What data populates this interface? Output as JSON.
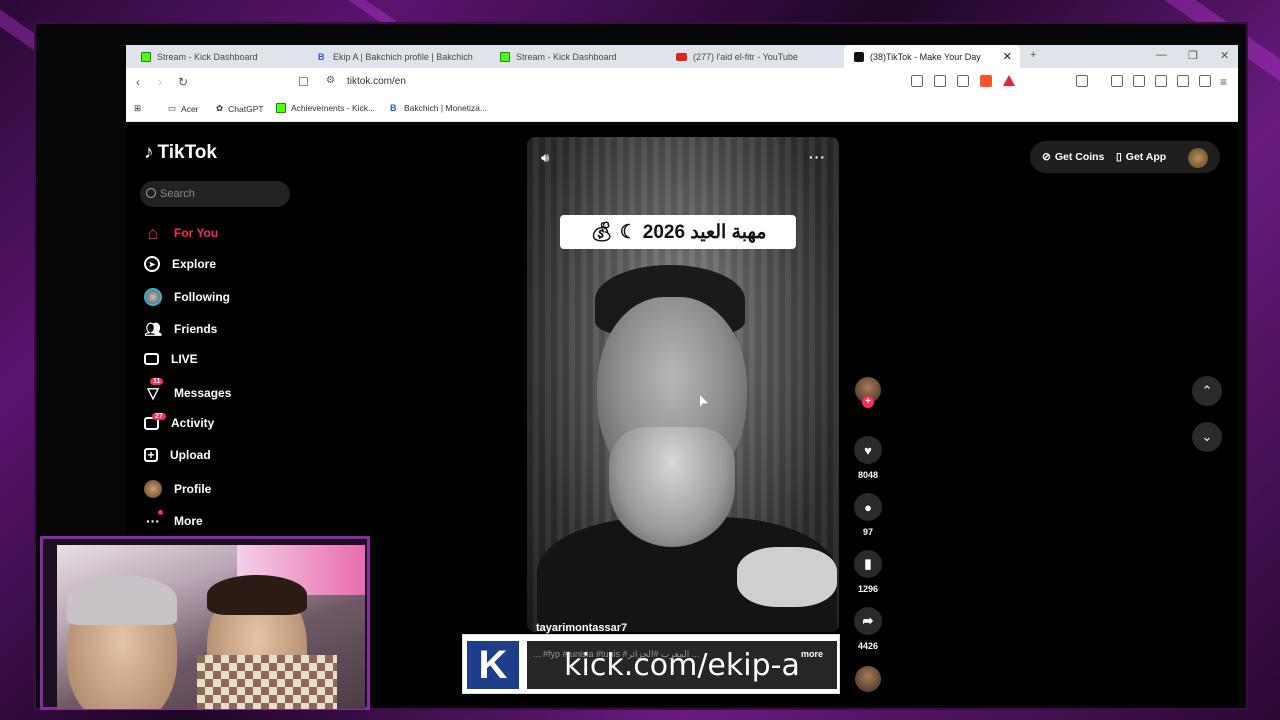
{
  "browser": {
    "tabs": [
      {
        "title": "Stream - Kick Dashboard",
        "favicon": "kick-icon",
        "active": false
      },
      {
        "title": "Ekip A | Bakchich profile | Bakchich",
        "favicon": "bakchich-icon",
        "active": false
      },
      {
        "title": "Stream - Kick Dashboard",
        "favicon": "kick-icon",
        "active": false
      },
      {
        "title": "(277) l'aid el-fitr - YouTube",
        "favicon": "youtube-icon",
        "active": false
      },
      {
        "title": "(38)TikTok - Make Your Day",
        "favicon": "tiktok-icon",
        "active": true
      }
    ],
    "url": "tiktok.com/en",
    "bookmarks": [
      "Acer",
      "ChatGPT",
      "Achievements - Kick...",
      "Bakchich | Monetiza..."
    ]
  },
  "tiktok": {
    "logo": "TikTok",
    "search_placeholder": "Search",
    "nav": [
      {
        "label": "For You",
        "icon": "home-icon",
        "active": true
      },
      {
        "label": "Explore",
        "icon": "compass-icon"
      },
      {
        "label": "Following",
        "icon": "following-avatar-icon"
      },
      {
        "label": "Friends",
        "icon": "friends-icon"
      },
      {
        "label": "LIVE",
        "icon": "live-tv-icon"
      },
      {
        "label": "Messages",
        "icon": "send-icon",
        "badge": "11"
      },
      {
        "label": "Activity",
        "icon": "activity-icon",
        "badge": "27"
      },
      {
        "label": "Upload",
        "icon": "upload-icon"
      },
      {
        "label": "Profile",
        "icon": "profile-avatar-icon"
      },
      {
        "label": "More",
        "icon": "more-dots-icon"
      }
    ],
    "top": {
      "get_coins": "Get Coins",
      "get_app": "Get App"
    },
    "video": {
      "caption_overlay": "مهبة العيد 2026",
      "author": "tayarimontassar7",
      "description": "... #fyp #tunisia #tunis #المغرب #الجزائر ... ",
      "more": "more"
    },
    "actions": {
      "likes": "8048",
      "comments": "97",
      "saves": "1296",
      "shares": "4426"
    }
  },
  "overlay": {
    "kick_url": "kick.com/ekip-a",
    "kick_logo": "K"
  },
  "colors": {
    "accent": "#fe2c55",
    "frame": "#8a2ba0",
    "kick_blue": "#1e3d8a"
  }
}
